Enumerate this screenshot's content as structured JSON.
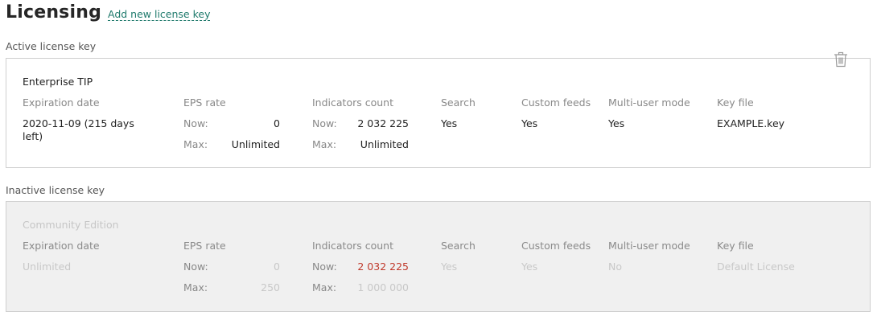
{
  "page": {
    "title": "Licensing",
    "add_link": "Add new license key"
  },
  "active": {
    "section_label": "Active license key",
    "name": "Enterprise TIP",
    "headers": {
      "expiration": "Expiration date",
      "eps": "EPS rate",
      "indicators": "Indicators count",
      "search": "Search",
      "custom_feeds": "Custom feeds",
      "multi_user": "Multi-user mode",
      "key_file": "Key file"
    },
    "expiration": "2020-11-09 (215 days left)",
    "eps": {
      "now_label": "Now:",
      "now": "0",
      "max_label": "Max:",
      "max": "Unlimited"
    },
    "indicators": {
      "now_label": "Now:",
      "now": "2 032 225",
      "max_label": "Max:",
      "max": "Unlimited"
    },
    "search": "Yes",
    "custom_feeds": "Yes",
    "multi_user": "Yes",
    "key_file": "EXAMPLE.key",
    "delete_icon": "trash-icon"
  },
  "inactive": {
    "section_label": "Inactive license key",
    "name": "Community Edition",
    "headers": {
      "expiration": "Expiration date",
      "eps": "EPS rate",
      "indicators": "Indicators count",
      "search": "Search",
      "custom_feeds": "Custom feeds",
      "multi_user": "Multi-user mode",
      "key_file": "Key file"
    },
    "expiration": "Unlimited",
    "eps": {
      "now_label": "Now:",
      "now": "0",
      "max_label": "Max:",
      "max": "250"
    },
    "indicators": {
      "now_label": "Now:",
      "now": "2 032 225",
      "max_label": "Max:",
      "max": "1 000 000"
    },
    "search": "Yes",
    "custom_feeds": "Yes",
    "multi_user": "No",
    "key_file": "Default License"
  },
  "colors": {
    "link": "#1f7a6c",
    "alert": "#c0392b",
    "inactive_bg": "#f0f0f0"
  }
}
